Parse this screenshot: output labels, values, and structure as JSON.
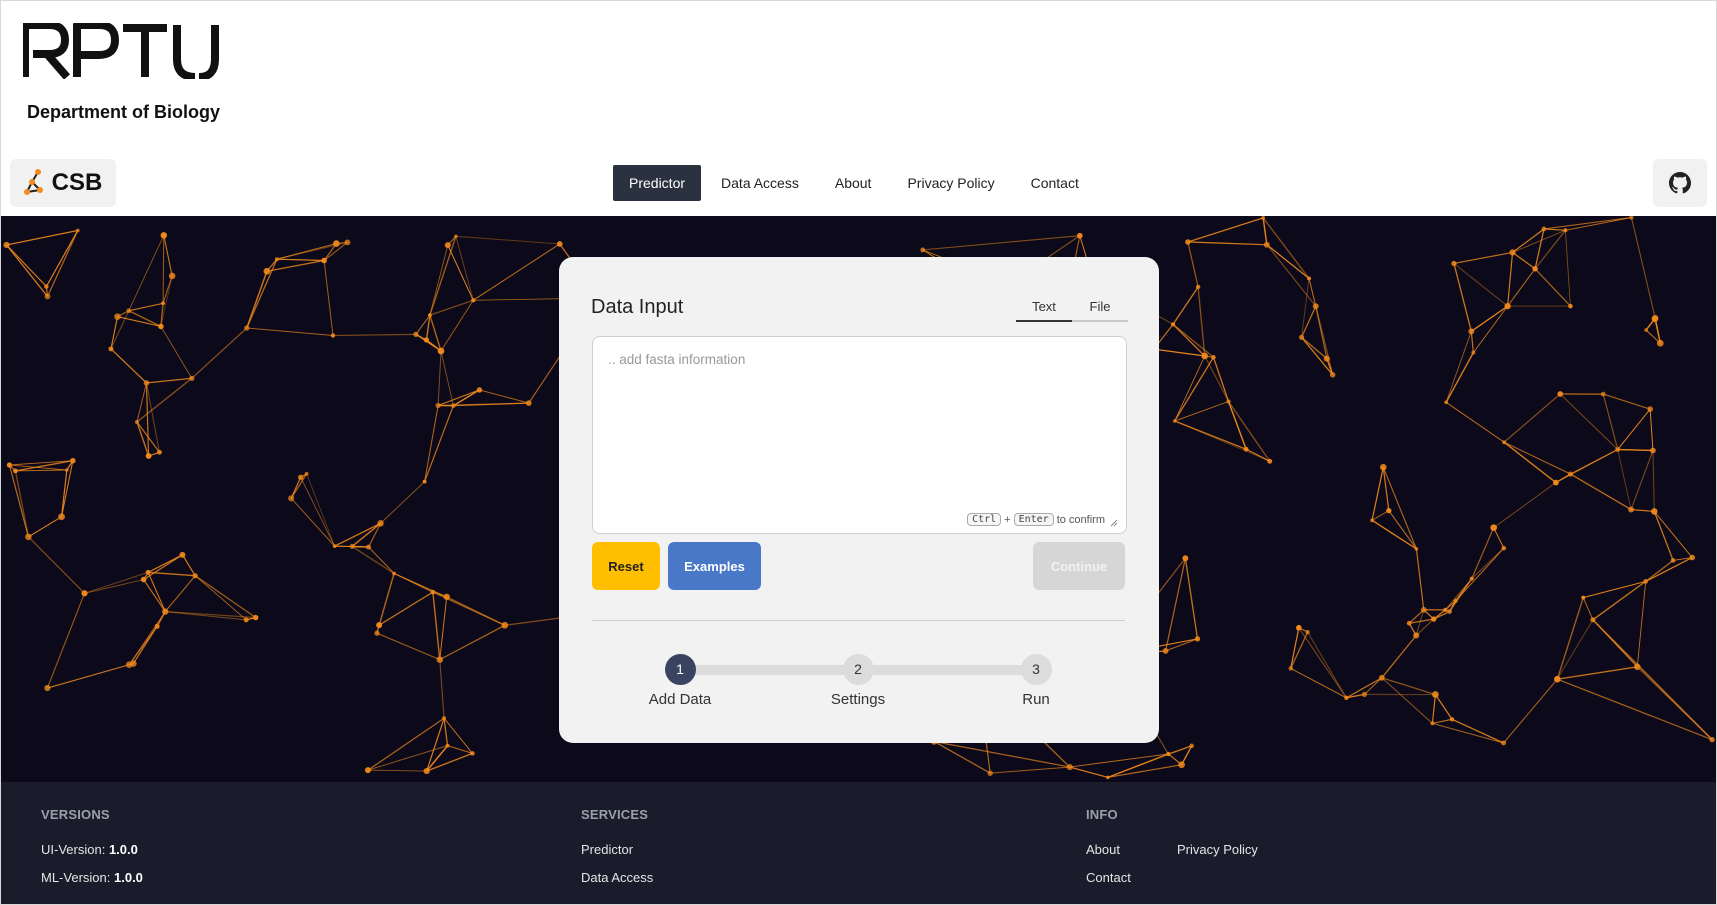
{
  "header": {
    "brand": "RPTU",
    "department": "Department of Biology",
    "lab_label": "CSB",
    "nav": [
      {
        "label": "Predictor",
        "active": true
      },
      {
        "label": "Data Access",
        "active": false
      },
      {
        "label": "About",
        "active": false
      },
      {
        "label": "Privacy Policy",
        "active": false
      },
      {
        "label": "Contact",
        "active": false
      }
    ],
    "icons": {
      "lab": "molecule-icon",
      "repo": "github-icon"
    }
  },
  "card": {
    "title": "Data Input",
    "tabs": [
      {
        "label": "Text",
        "active": true
      },
      {
        "label": "File",
        "active": false
      }
    ],
    "input_placeholder": ".. add fasta information",
    "input_value": "",
    "hint": {
      "key1": "Ctrl",
      "plus": "+",
      "key2": "Enter",
      "suffix": "to confirm"
    },
    "buttons": {
      "reset": "Reset",
      "examples": "Examples",
      "continue": "Continue"
    },
    "steps": [
      {
        "number": "1",
        "label": "Add Data",
        "active": true
      },
      {
        "number": "2",
        "label": "Settings",
        "active": false
      },
      {
        "number": "3",
        "label": "Run",
        "active": false
      }
    ]
  },
  "footer": {
    "versions": {
      "title": "VERSIONS",
      "ui_label": "UI-Version:",
      "ui_value": "1.0.0",
      "ml_label": "ML-Version:",
      "ml_value": "1.0.0"
    },
    "services": {
      "title": "SERVICES",
      "items": [
        "Predictor",
        "Data Access"
      ]
    },
    "info": {
      "title": "INFO",
      "items": [
        "About",
        "Privacy Policy",
        "Contact"
      ]
    }
  },
  "colors": {
    "accent_orange": "#f28a1c",
    "nav_active": "#2a3240",
    "reset": "#ffbf00",
    "examples": "#4a78c9",
    "hero_bg": "#0c0a1a",
    "footer_bg": "#1a1c2c"
  }
}
